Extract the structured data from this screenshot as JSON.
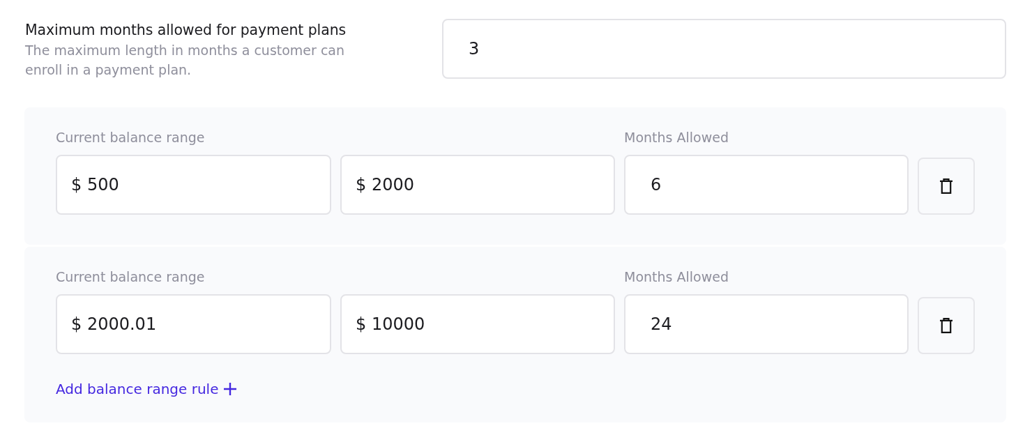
{
  "max_months": {
    "label": "Maximum months allowed for payment plans",
    "description": "The maximum length in months a customer can enroll in a payment plan.",
    "value": "3"
  },
  "rules": [
    {
      "range_label": "Current balance range",
      "min": "$ 500",
      "max": "$ 2000",
      "months_label": "Months Allowed",
      "months": "6"
    },
    {
      "range_label": "Current balance range",
      "min": "$ 2000.01",
      "max": "$ 10000",
      "months_label": "Months Allowed",
      "months": "24"
    }
  ],
  "add_link": {
    "label": "Add balance range rule"
  }
}
